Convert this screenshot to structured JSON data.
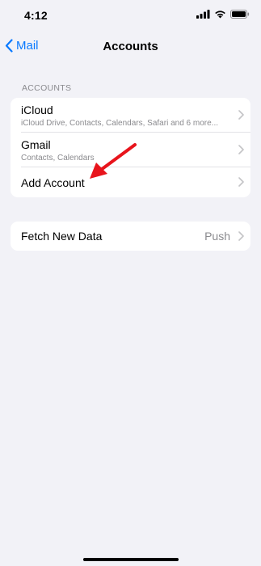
{
  "status_bar": {
    "time": "4:12"
  },
  "nav": {
    "back_label": "Mail",
    "title": "Accounts"
  },
  "accounts_section": {
    "header": "ACCOUNTS",
    "items": [
      {
        "title": "iCloud",
        "subtitle": "iCloud Drive, Contacts, Calendars, Safari and 6 more..."
      },
      {
        "title": "Gmail",
        "subtitle": "Contacts, Calendars"
      },
      {
        "title": "Add Account"
      }
    ]
  },
  "fetch_section": {
    "title": "Fetch New Data",
    "value": "Push"
  },
  "colors": {
    "accent": "#0a7aff",
    "background": "#f2f2f7",
    "annotation": "#e8141c"
  }
}
